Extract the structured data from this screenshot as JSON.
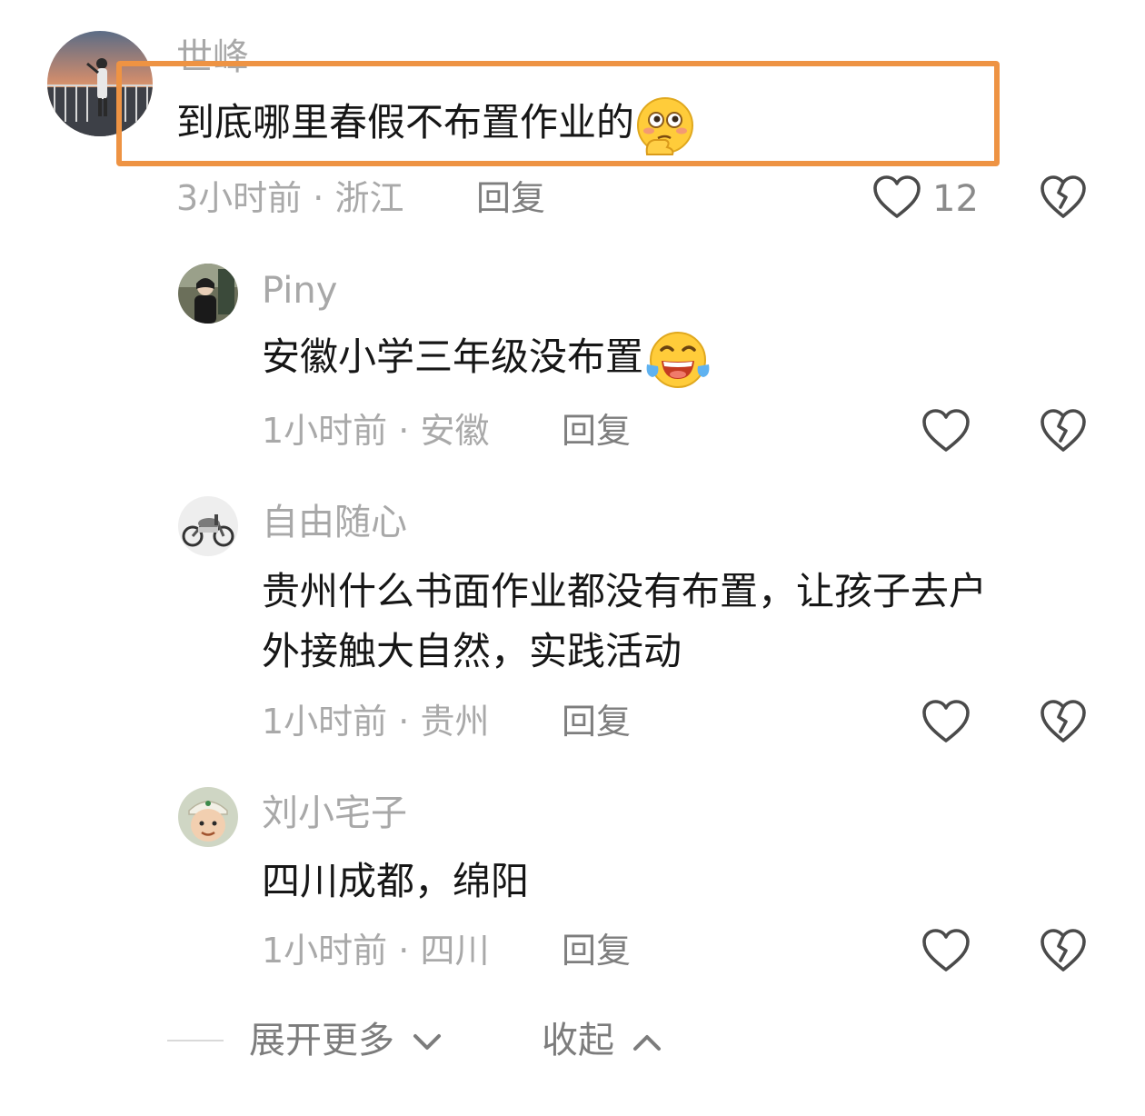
{
  "comments": [
    {
      "username": "世峰",
      "text": "到底哪里春假不布置作业的",
      "emoji": "flushed-thinking-emoji",
      "time": "3小时前",
      "location": "浙江",
      "reply": "回复",
      "likes": "12"
    },
    {
      "username": "Piny",
      "text": "安徽小学三年级没布置",
      "emoji": "tears-of-joy-emoji",
      "time": "1小时前",
      "location": "安徽",
      "reply": "回复"
    },
    {
      "username": "自由随心",
      "text_line1": "贵州什么书面作业都没有布置，让孩子去户",
      "text_line2": "外接触大自然，实践活动",
      "time": "1小时前",
      "location": "贵州",
      "reply": "回复"
    },
    {
      "username": "刘小宅子",
      "text": "四川成都，绵阳",
      "time": "1小时前",
      "location": "四川",
      "reply": "回复"
    }
  ],
  "meta_separator": " · ",
  "footer": {
    "expand_more": "展开更多",
    "collapse": "收起"
  },
  "colors": {
    "highlight": "#ee9343",
    "text": "#161616",
    "muted": "#a9a9a9"
  }
}
